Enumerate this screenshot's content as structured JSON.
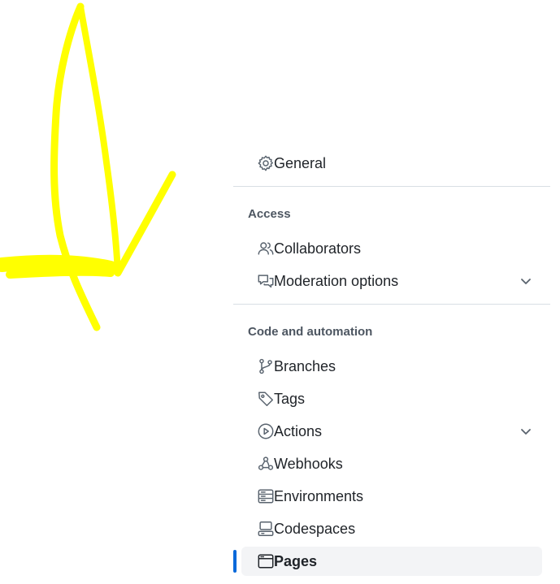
{
  "nav": {
    "general": "General",
    "access_heading": "Access",
    "collaborators": "Collaborators",
    "moderation": "Moderation options",
    "code_heading": "Code and automation",
    "branches": "Branches",
    "tags": "Tags",
    "actions": "Actions",
    "webhooks": "Webhooks",
    "environments": "Environments",
    "codespaces": "Codespaces",
    "pages": "Pages"
  },
  "colors": {
    "accent": "#0969da",
    "annotation": "#ffff00",
    "text": "#1f2328",
    "icon": "#59636e"
  }
}
